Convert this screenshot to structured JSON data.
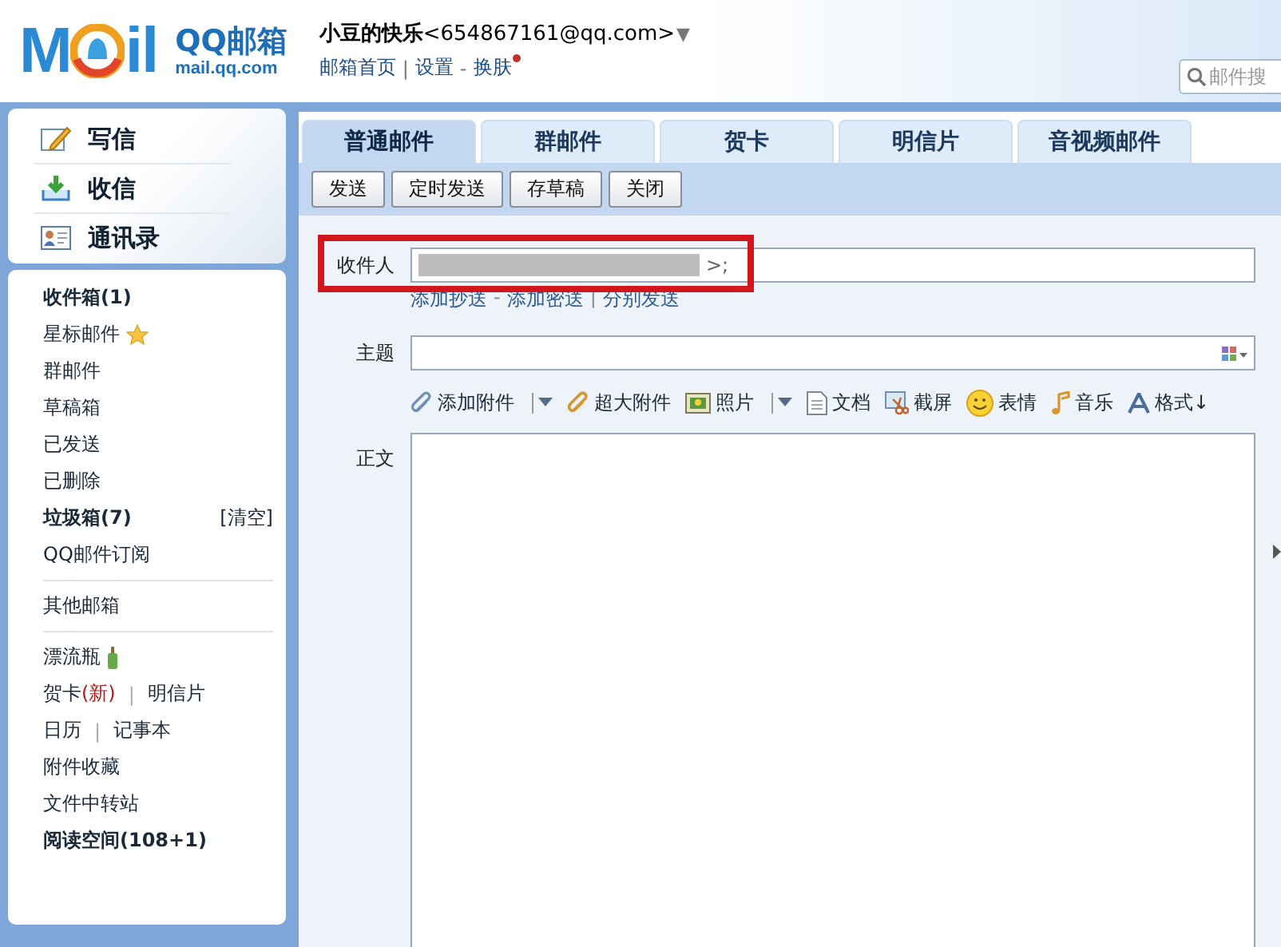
{
  "header": {
    "logo": {
      "mark_left": "M",
      "mark_right": "il",
      "name": "QQ邮箱",
      "domain": "mail.qq.com"
    },
    "user": {
      "name": "小豆的快乐",
      "email": "<654867161@qq.com>",
      "caret": "▼"
    },
    "links": [
      {
        "label": "邮箱首页"
      },
      {
        "sep": "|",
        "label": "设置"
      },
      {
        "sep": "-",
        "label": "换肤",
        "notice": true
      }
    ],
    "search": {
      "placeholder": "邮件搜"
    }
  },
  "sidebar": {
    "quick_actions": [
      {
        "kind": "write",
        "label": "写信"
      },
      {
        "kind": "receive",
        "label": "收信"
      },
      {
        "kind": "contacts",
        "label": "通讯录"
      }
    ],
    "groups": [
      [
        {
          "kind": "plain",
          "label": "收件箱(1)",
          "bold": true
        },
        {
          "kind": "star",
          "label": "星标邮件",
          "bold": false
        },
        {
          "kind": "plain",
          "label": "群邮件",
          "bold": false
        },
        {
          "kind": "plain",
          "label": "草稿箱",
          "bold": false
        },
        {
          "kind": "plain",
          "label": "已发送",
          "bold": false
        },
        {
          "kind": "plain",
          "label": "已删除",
          "bold": false
        },
        {
          "kind": "plain",
          "label": "垃圾箱(7)",
          "bold": true,
          "action": "[清空]"
        },
        {
          "kind": "plain",
          "label": "QQ邮件订阅",
          "bold": false
        }
      ],
      [
        {
          "kind": "plain",
          "label": "其他邮箱",
          "bold": false
        }
      ],
      [
        {
          "kind": "bottle",
          "label": "漂流瓶",
          "bold": false
        },
        {
          "kind": "plain",
          "label": "贺卡",
          "badge": "(新)",
          "bold": false,
          "extra": [
            {
              "sep": "|",
              "label": "明信片"
            }
          ]
        },
        {
          "kind": "plain",
          "label": "日历",
          "bold": false,
          "extra": [
            {
              "sep": "|",
              "label": "记事本"
            }
          ]
        },
        {
          "kind": "plain",
          "label": "附件收藏",
          "bold": false
        },
        {
          "kind": "plain",
          "label": "文件中转站",
          "bold": false
        },
        {
          "kind": "plain",
          "label": "阅读空间(108+1)",
          "bold": true
        }
      ]
    ]
  },
  "compose": {
    "tabs": [
      {
        "label": "普通邮件",
        "selected": true
      },
      {
        "label": "群邮件",
        "selected": false
      },
      {
        "label": "贺卡",
        "selected": false
      },
      {
        "label": "明信片",
        "selected": false
      },
      {
        "label": "音视频邮件",
        "selected": false
      }
    ],
    "buttons": [
      "发送",
      "定时发送",
      "存草稿",
      "关闭"
    ],
    "recipient": {
      "label": "收件人",
      "value": ">;",
      "redacted": true,
      "highlighted": true
    },
    "recipient_links": [
      {
        "label": "添加抄送"
      },
      {
        "sep": "-",
        "label": "添加密送"
      },
      {
        "sep": "|",
        "label": "分别发送"
      }
    ],
    "subject": {
      "label": "主题"
    },
    "attach_tools": [
      {
        "kind": "paperclip",
        "label": "添加附件",
        "dropdown": true
      },
      {
        "kind": "bigclip",
        "label": "超大附件",
        "dropdown": false
      },
      {
        "kind": "photo",
        "label": "照片",
        "dropdown": true
      },
      {
        "kind": "doc",
        "label": "文档",
        "dropdown": false
      },
      {
        "kind": "screenshot",
        "label": "截屏",
        "dropdown": false
      },
      {
        "kind": "smiley",
        "label": "表情",
        "dropdown": false
      },
      {
        "kind": "music",
        "label": "音乐",
        "dropdown": false
      },
      {
        "kind": "format",
        "label": "格式↓",
        "dropdown": false
      }
    ],
    "body": {
      "label": "正文"
    }
  }
}
